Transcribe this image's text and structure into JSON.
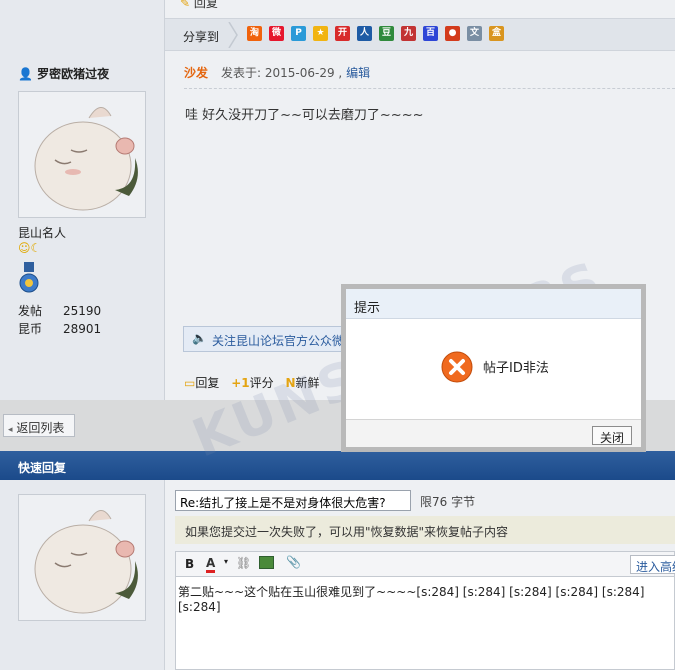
{
  "top_reply_label": "回复",
  "share": {
    "label": "分享到",
    "icons": [
      {
        "name": "taobao-icon",
        "glyph": "淘",
        "color": "#f0620c"
      },
      {
        "name": "weibo-icon",
        "glyph": "微",
        "color": "#e6162d"
      },
      {
        "name": "tencent-weibo-icon",
        "glyph": "P",
        "color": "#2a9ad8"
      },
      {
        "name": "qzone-icon",
        "glyph": "★",
        "color": "#f1b412"
      },
      {
        "name": "kaixin-icon",
        "glyph": "开",
        "color": "#d82a2a"
      },
      {
        "name": "renren-icon",
        "glyph": "人",
        "color": "#1e5ba5"
      },
      {
        "name": "douban-icon",
        "glyph": "豆",
        "color": "#2f8a3c"
      },
      {
        "name": "douban9-icon",
        "glyph": "九",
        "color": "#c23333"
      },
      {
        "name": "baidu-icon",
        "glyph": "百",
        "color": "#2e46d6"
      },
      {
        "name": "apple-icon",
        "glyph": "●",
        "color": "#d33b1c"
      },
      {
        "name": "doc-icon",
        "glyph": "文",
        "color": "#7a8ea3"
      },
      {
        "name": "box-icon",
        "glyph": "盒",
        "color": "#d9951f"
      }
    ]
  },
  "author": {
    "name": "罗密欧猪过夜",
    "title": "昆山名人",
    "posts_label": "发帖",
    "posts_value": "25190",
    "coins_label": "昆币",
    "coins_value": "28901"
  },
  "post": {
    "floor": "沙发",
    "meta_prefix": "发表于: 2015-06-29 ,",
    "edit_link": "编辑",
    "body": "哇  好久没开刀了~~可以去磨刀了~~~~",
    "wechat_notice": "关注昆山论坛官方公众微",
    "actions": {
      "reply": "回复",
      "rate": "评分",
      "new": "新鲜"
    }
  },
  "back_label": "返回列表",
  "quick_reply": {
    "header": "快速回复",
    "title_value": "Re:结扎了接上是不是对身体很大危害?",
    "title_limit": "限76 字节",
    "restore_notice": "如果您提交过一次失败了，可以用\"恢复数据\"来恢复帖子内容",
    "advanced_label": "进入高级",
    "editor_text": "第二贴~~~这个贴在玉山很难见到了~~~~[s:284] [s:284] [s:284] [s:284] [s:284] [s:284]"
  },
  "dialog": {
    "title": "提示",
    "message": "帖子ID非法",
    "close_label": "关闭"
  },
  "watermark": "KUNSHANBBS"
}
